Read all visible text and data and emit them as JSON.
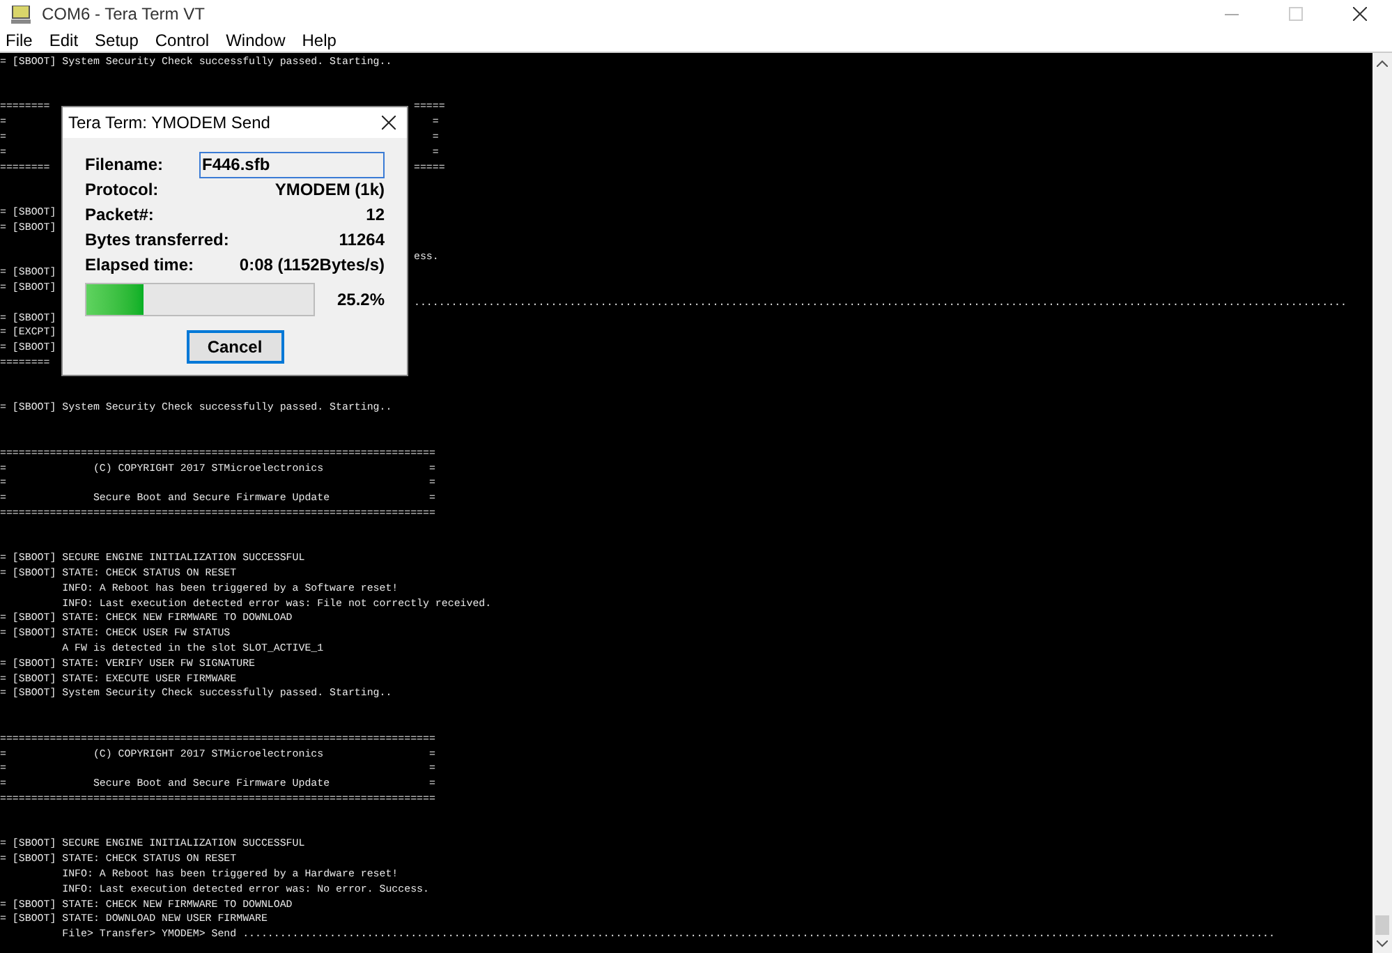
{
  "window": {
    "title": "COM6 - Tera Term VT"
  },
  "menu": [
    "File",
    "Edit",
    "Setup",
    "Control",
    "Window",
    "Help"
  ],
  "terminal": {
    "lines": [
      {
        "kind": "text",
        "text": "= [SBOOT] System Security Check successfully passed. Starting.."
      },
      {
        "kind": "blank"
      },
      {
        "kind": "blank"
      },
      {
        "kind": "text",
        "text": "========",
        "right": "====="
      },
      {
        "kind": "text",
        "text": "=",
        "right": "   ="
      },
      {
        "kind": "text",
        "text": "=",
        "right": "   ="
      },
      {
        "kind": "text",
        "text": "=",
        "right": "   ="
      },
      {
        "kind": "text",
        "text": "========",
        "right": "====="
      },
      {
        "kind": "blank"
      },
      {
        "kind": "blank"
      },
      {
        "kind": "text",
        "text": "= [SBOOT]"
      },
      {
        "kind": "text",
        "text": "= [SBOOT]"
      },
      {
        "kind": "blank"
      },
      {
        "kind": "text",
        "right": "ess."
      },
      {
        "kind": "text",
        "text": "= [SBOOT]"
      },
      {
        "kind": "text",
        "text": "= [SBOOT]"
      },
      {
        "kind": "text",
        "right": "......................................................................................................................................................"
      },
      {
        "kind": "text",
        "text": "= [SBOOT]"
      },
      {
        "kind": "text",
        "text": "= [EXCPT]"
      },
      {
        "kind": "text",
        "text": "= [SBOOT]"
      },
      {
        "kind": "text",
        "text": "========"
      },
      {
        "kind": "blank"
      },
      {
        "kind": "blank"
      },
      {
        "kind": "text",
        "text": "= [SBOOT] System Security Check successfully passed. Starting.."
      },
      {
        "kind": "blank"
      },
      {
        "kind": "blank"
      },
      {
        "kind": "text",
        "text": "======================================================================"
      },
      {
        "kind": "text",
        "text": "=              (C) COPYRIGHT 2017 STMicroelectronics                 ="
      },
      {
        "kind": "text",
        "text": "=                                                                    ="
      },
      {
        "kind": "text",
        "text": "=              Secure Boot and Secure Firmware Update                ="
      },
      {
        "kind": "text",
        "text": "======================================================================"
      },
      {
        "kind": "blank"
      },
      {
        "kind": "blank"
      },
      {
        "kind": "text",
        "text": "= [SBOOT] SECURE ENGINE INITIALIZATION SUCCESSFUL"
      },
      {
        "kind": "text",
        "text": "= [SBOOT] STATE: CHECK STATUS ON RESET"
      },
      {
        "kind": "text",
        "text": "          INFO: A Reboot has been triggered by a Software reset!"
      },
      {
        "kind": "text",
        "text": "          INFO: Last execution detected error was: File not correctly received."
      },
      {
        "kind": "text",
        "text": "= [SBOOT] STATE: CHECK NEW FIRMWARE TO DOWNLOAD"
      },
      {
        "kind": "text",
        "text": "= [SBOOT] STATE: CHECK USER FW STATUS"
      },
      {
        "kind": "text",
        "text": "          A FW is detected in the slot SLOT_ACTIVE_1"
      },
      {
        "kind": "text",
        "text": "= [SBOOT] STATE: VERIFY USER FW SIGNATURE"
      },
      {
        "kind": "text",
        "text": "= [SBOOT] STATE: EXECUTE USER FIRMWARE"
      },
      {
        "kind": "text",
        "text": "= [SBOOT] System Security Check successfully passed. Starting.."
      },
      {
        "kind": "blank"
      },
      {
        "kind": "blank"
      },
      {
        "kind": "text",
        "text": "======================================================================"
      },
      {
        "kind": "text",
        "text": "=              (C) COPYRIGHT 2017 STMicroelectronics                 ="
      },
      {
        "kind": "text",
        "text": "=                                                                    ="
      },
      {
        "kind": "text",
        "text": "=              Secure Boot and Secure Firmware Update                ="
      },
      {
        "kind": "text",
        "text": "======================================================================"
      },
      {
        "kind": "blank"
      },
      {
        "kind": "blank"
      },
      {
        "kind": "text",
        "text": "= [SBOOT] SECURE ENGINE INITIALIZATION SUCCESSFUL"
      },
      {
        "kind": "text",
        "text": "= [SBOOT] STATE: CHECK STATUS ON RESET"
      },
      {
        "kind": "text",
        "text": "          INFO: A Reboot has been triggered by a Hardware reset!"
      },
      {
        "kind": "text",
        "text": "          INFO: Last execution detected error was: No error. Success."
      },
      {
        "kind": "text",
        "text": "= [SBOOT] STATE: CHECK NEW FIRMWARE TO DOWNLOAD"
      },
      {
        "kind": "text",
        "text": "= [SBOOT] STATE: DOWNLOAD NEW USER FIRMWARE"
      },
      {
        "kind": "text",
        "text": "          File> Transfer> YMODEM> Send ......................................................................................................................................................................"
      }
    ]
  },
  "dialog": {
    "title": "Tera Term: YMODEM Send",
    "fields": [
      {
        "label": "Filename:",
        "value": "F446.sfb",
        "kind": "input"
      },
      {
        "label": "Protocol:",
        "value": "YMODEM (1k)",
        "kind": "text"
      },
      {
        "label": "Packet#:",
        "value": "12",
        "kind": "text"
      },
      {
        "label": "Bytes transferred:",
        "value": "11264",
        "kind": "text"
      },
      {
        "label": "Elapsed time:",
        "value": "0:08 (1152Bytes/s)",
        "kind": "text"
      }
    ],
    "progress": {
      "level": 0.252,
      "reading": "25.2%"
    },
    "buttons": [
      {
        "label": "Cancel",
        "default": true
      }
    ]
  }
}
